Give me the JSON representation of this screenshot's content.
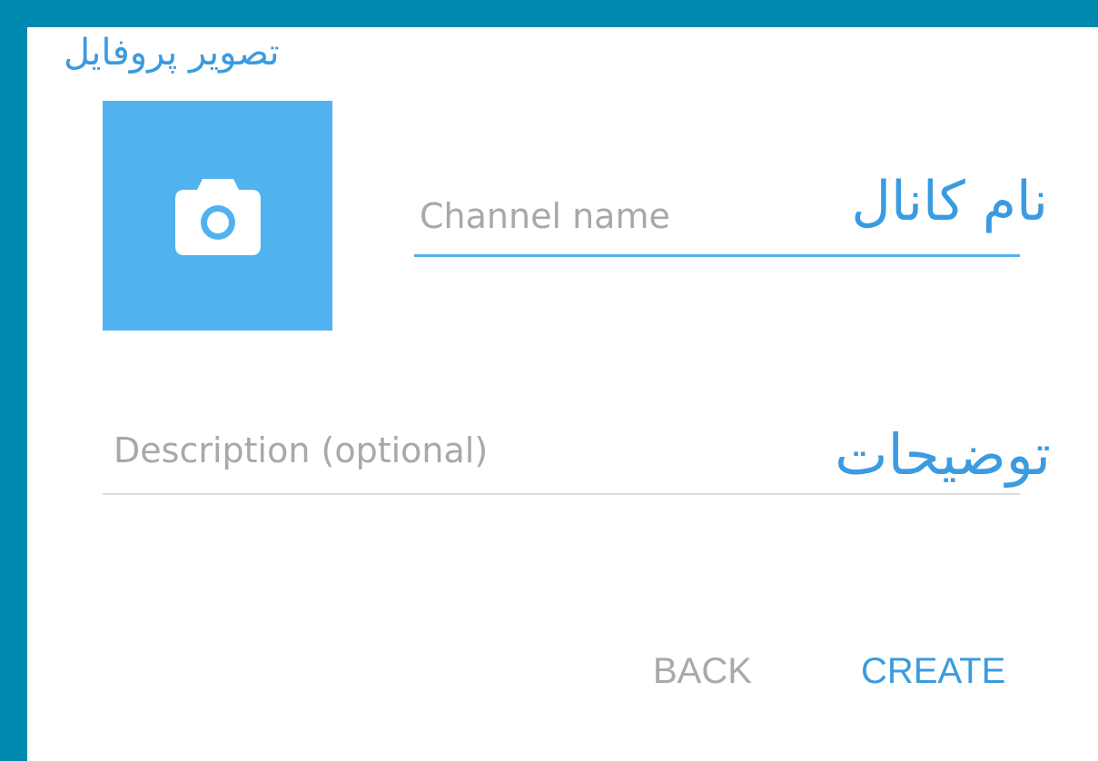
{
  "annotations": {
    "profile_photo": "تصویر پروفایل",
    "channel_name": "نام کانال",
    "description": "توضیحات"
  },
  "form": {
    "channel_name_placeholder": "Channel name",
    "description_placeholder": "Description (optional)"
  },
  "buttons": {
    "back": "BACK",
    "create": "CREATE"
  },
  "icons": {
    "avatar": "camera-icon"
  },
  "colors": {
    "frame": "#0089AE",
    "accent": "#50B3F0",
    "annotation": "#3A9BE0",
    "muted_button": "#A9A9A9"
  }
}
